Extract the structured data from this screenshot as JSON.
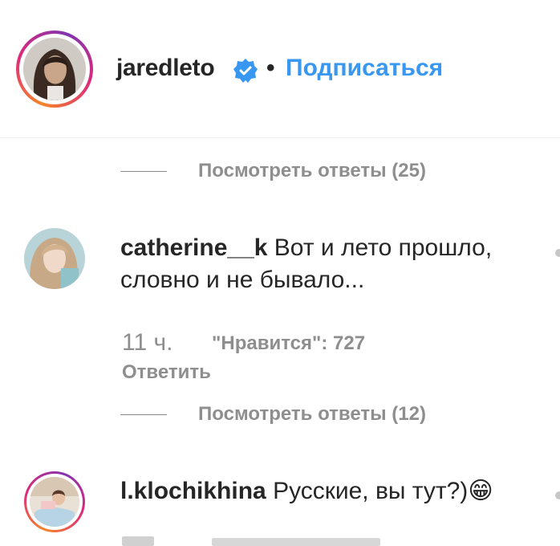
{
  "header": {
    "username": "jaredleto",
    "separator": "•",
    "follow_label": "Подписаться",
    "verified_icon": "verified-badge-icon",
    "accent_color": "#3897f0"
  },
  "replies_1": {
    "label": "Посмотреть ответы (25)"
  },
  "comments": [
    {
      "username": "catherine__k",
      "text_line1": "Вот и лето прошло,",
      "text_line2": "словно и не бывало...",
      "time": "11 ч.",
      "likes": "\"Нравится\": 727",
      "reply_label": "Ответить"
    },
    {
      "username": "l.klochikhina",
      "text": "Русские, вы тут?)",
      "emoji": "😁"
    }
  ],
  "replies_2": {
    "label": "Посмотреть ответы (12)"
  }
}
